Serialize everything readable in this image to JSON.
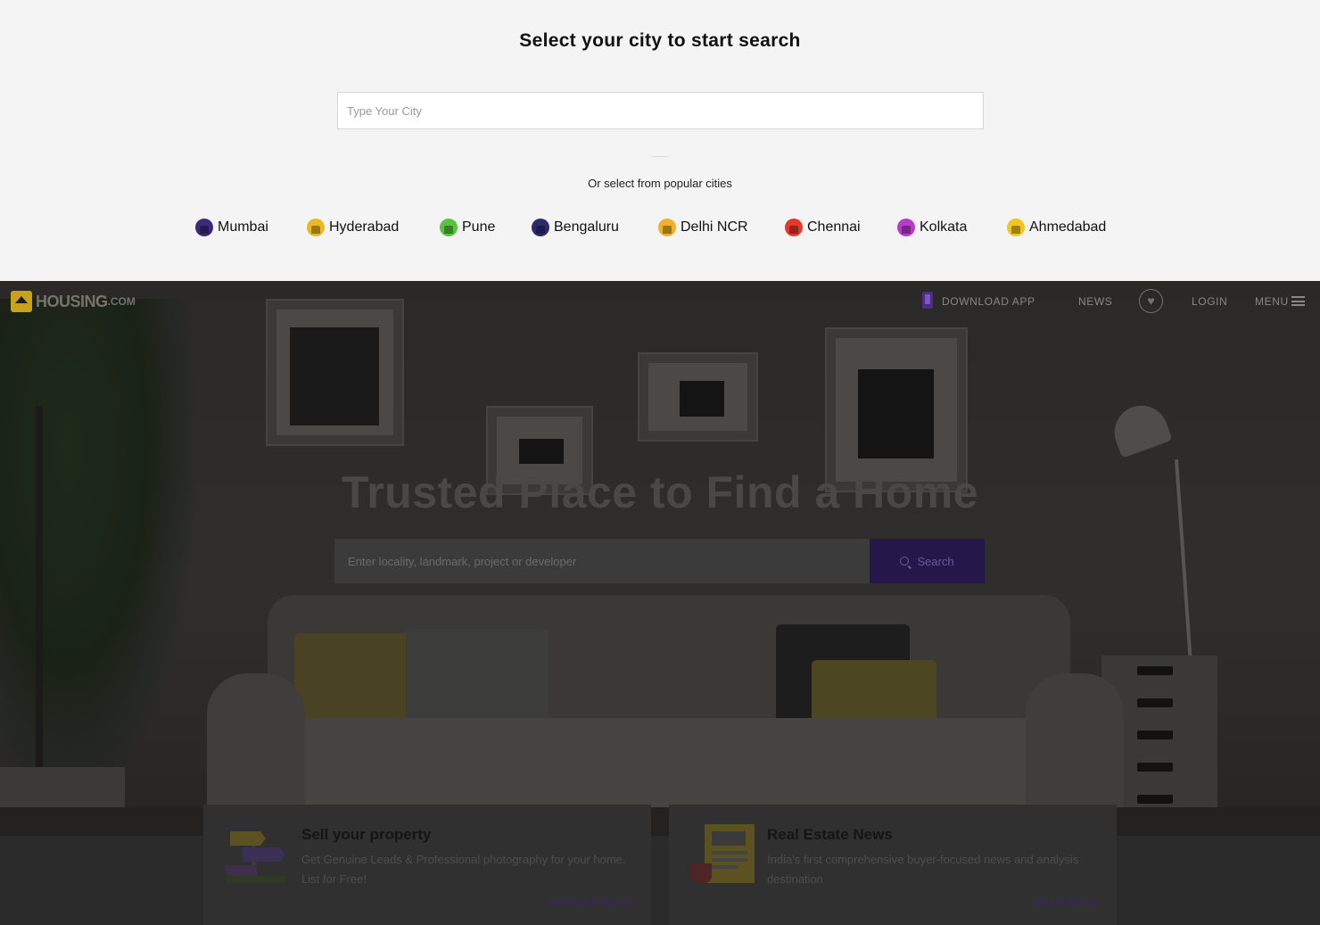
{
  "city_selector": {
    "title": "Select your city to start search",
    "input_placeholder": "Type Your City",
    "popular_label": "Or select from popular cities",
    "cities": [
      {
        "name": "Mumbai",
        "icon": "mumbai-icon",
        "color": "#3b2a7a"
      },
      {
        "name": "Hyderabad",
        "icon": "hyderabad-icon",
        "color": "#e8b923"
      },
      {
        "name": "Pune",
        "icon": "pune-icon",
        "color": "#58c43c"
      },
      {
        "name": "Bengaluru",
        "icon": "bengaluru-icon",
        "color": "#2d2a6e"
      },
      {
        "name": "Delhi NCR",
        "icon": "delhi-ncr-icon",
        "color": "#f0b12a"
      },
      {
        "name": "Chennai",
        "icon": "chennai-icon",
        "color": "#e5382c"
      },
      {
        "name": "Kolkata",
        "icon": "kolkata-icon",
        "color": "#b43cc9"
      },
      {
        "name": "Ahmedabad",
        "icon": "ahmedabad-icon",
        "color": "#f2c522"
      }
    ]
  },
  "nav": {
    "logo_text": "HOUSING",
    "logo_suffix": ".COM",
    "download_app": "DOWNLOAD APP",
    "news": "NEWS",
    "login": "LOGIN",
    "menu": "MENU"
  },
  "hero": {
    "title": "Trusted Place to Find a Home",
    "search_placeholder": "Enter locality, landmark, project or developer",
    "search_button": "Search"
  },
  "cards": [
    {
      "title": "Sell your property",
      "description": "Get Genuine Leads & Professional photography for your home. List for Free!",
      "link": "EXPLORE MORE",
      "icon": "signpost-icon"
    },
    {
      "title": "Real Estate News",
      "description": "India's first comprehensive buyer-focused news and analysis destination",
      "link": "READ MORE",
      "icon": "newspaper-icon"
    }
  ],
  "colors": {
    "brand_purple": "#4d2d86",
    "brand_yellow": "#c9a317"
  }
}
